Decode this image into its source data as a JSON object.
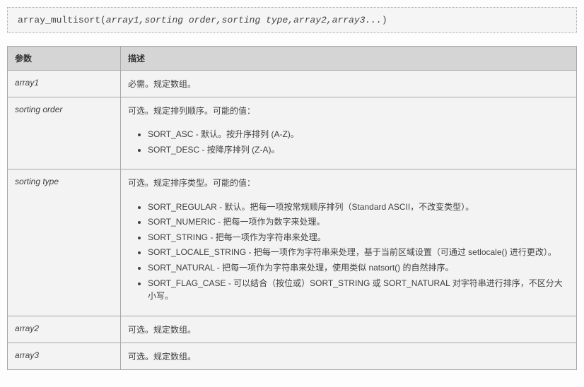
{
  "syntax": {
    "function": "array_multisort",
    "args": "array1,sorting order,sorting type,array2,array3..."
  },
  "table": {
    "headers": {
      "param": "参数",
      "desc": "描述"
    },
    "rows": {
      "array1": {
        "name": "array1",
        "desc": "必需。规定数组。"
      },
      "sorting_order": {
        "name": "sorting order",
        "lead": "可选。规定排列顺序。可能的值：",
        "items": [
          "SORT_ASC - 默认。按升序排列 (A-Z)。",
          "SORT_DESC - 按降序排列 (Z-A)。"
        ]
      },
      "sorting_type": {
        "name": "sorting type",
        "lead": "可选。规定排序类型。可能的值：",
        "items": [
          "SORT_REGULAR - 默认。把每一项按常规顺序排列（Standard ASCII，不改变类型）。",
          "SORT_NUMERIC - 把每一项作为数字来处理。",
          "SORT_STRING - 把每一项作为字符串来处理。",
          "SORT_LOCALE_STRING - 把每一项作为字符串来处理，基于当前区域设置（可通过 setlocale() 进行更改）。",
          "SORT_NATURAL - 把每一项作为字符串来处理，使用类似 natsort() 的自然排序。",
          "SORT_FLAG_CASE - 可以结合（按位或）SORT_STRING 或 SORT_NATURAL 对字符串进行排序，不区分大小写。"
        ]
      },
      "array2": {
        "name": "array2",
        "desc": "可选。规定数组。"
      },
      "array3": {
        "name": "array3",
        "desc": "可选。规定数组。"
      }
    }
  }
}
